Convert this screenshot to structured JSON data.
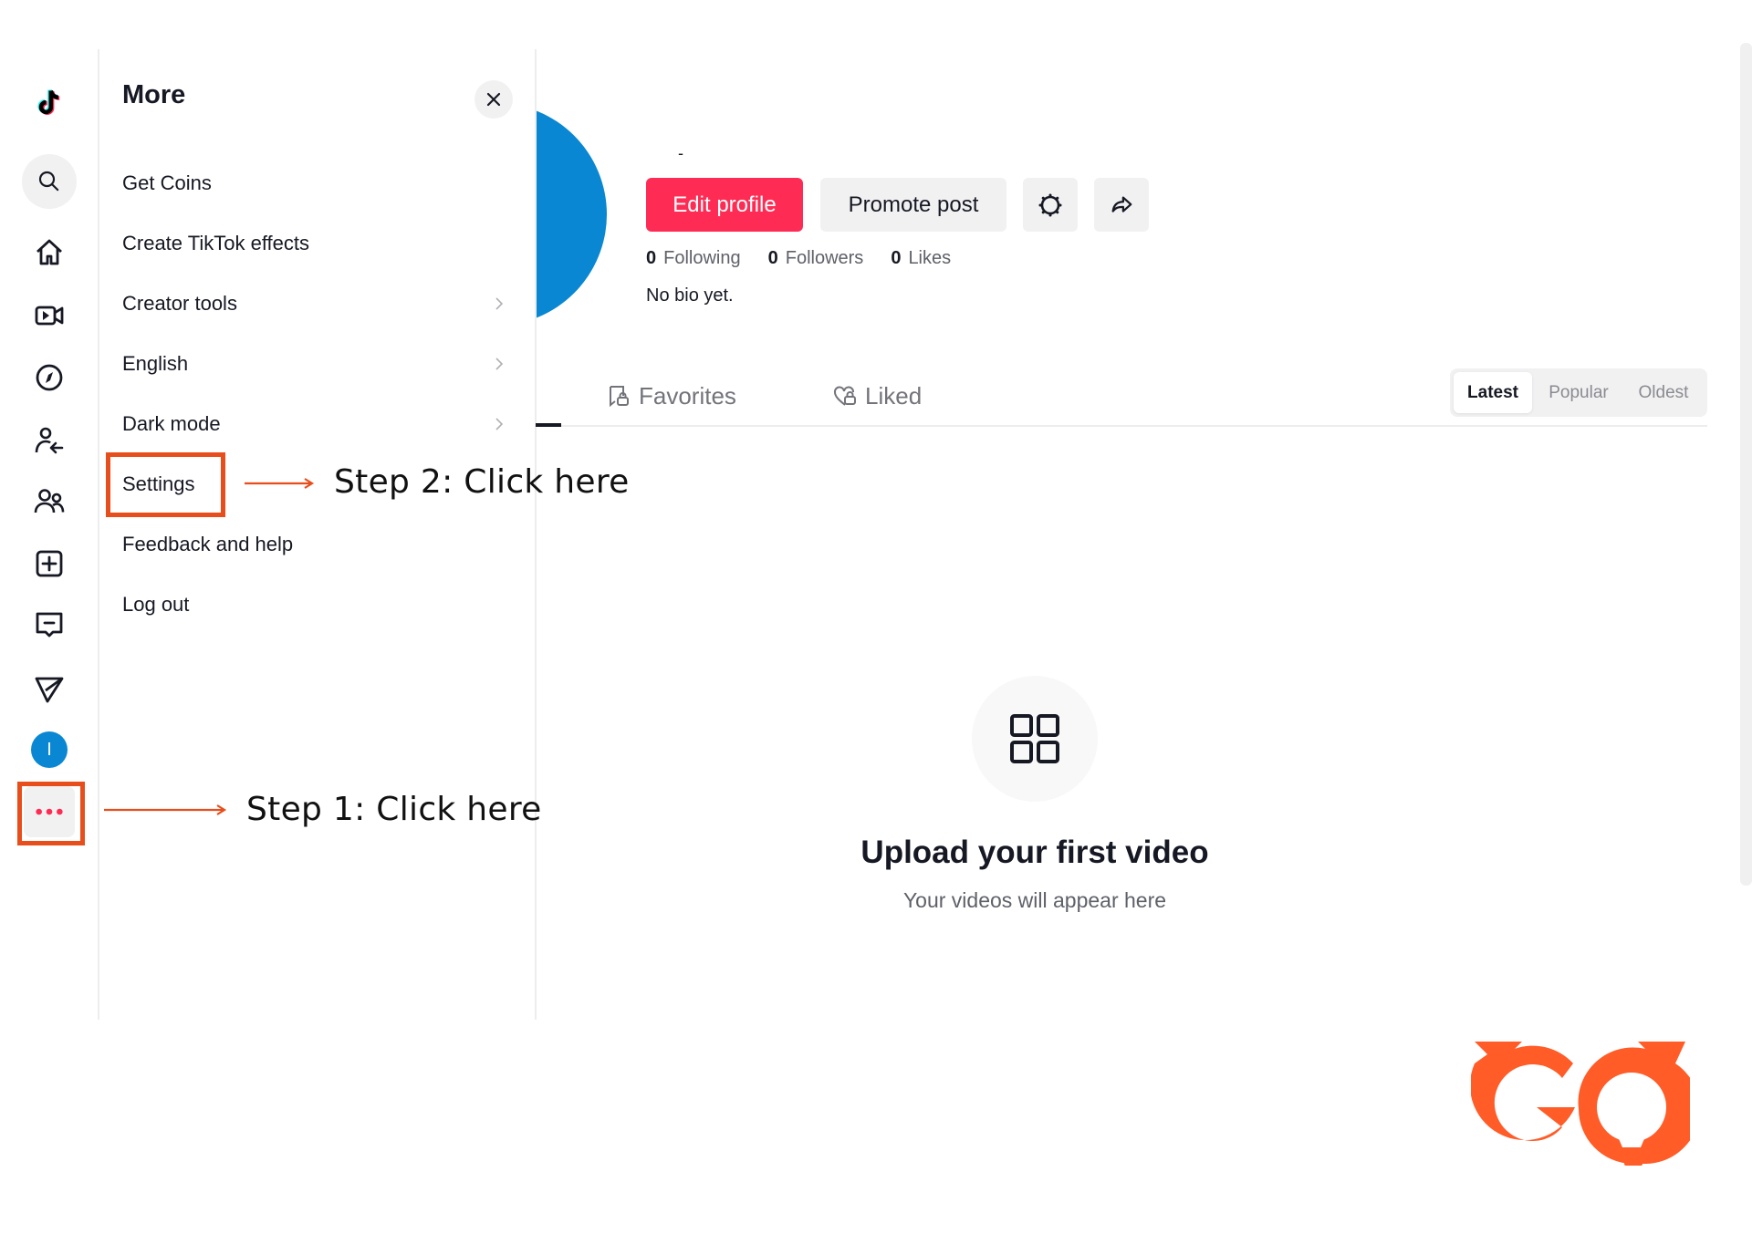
{
  "rail": {
    "items": [
      {
        "name": "tiktok-logo",
        "label": "TikTok"
      },
      {
        "name": "search",
        "label": "Search"
      },
      {
        "name": "home",
        "label": "For You"
      },
      {
        "name": "live",
        "label": "LIVE"
      },
      {
        "name": "explore",
        "label": "Explore"
      },
      {
        "name": "following",
        "label": "Following"
      },
      {
        "name": "friends",
        "label": "Friends"
      },
      {
        "name": "upload",
        "label": "Upload"
      },
      {
        "name": "activity",
        "label": "Activity"
      },
      {
        "name": "messages",
        "label": "Messages"
      },
      {
        "name": "profile",
        "label": "Profile"
      },
      {
        "name": "more",
        "label": "More"
      }
    ],
    "avatar_initial": "I",
    "accent": "#fe2c55"
  },
  "more_panel": {
    "title": "More",
    "close_label": "Close",
    "items": [
      {
        "label": "Get Coins",
        "has_submenu": false
      },
      {
        "label": "Create TikTok effects",
        "has_submenu": false
      },
      {
        "label": "Creator tools",
        "has_submenu": true
      },
      {
        "label": "English",
        "has_submenu": true
      },
      {
        "label": "Dark mode",
        "has_submenu": true
      },
      {
        "label": "Settings",
        "has_submenu": false
      },
      {
        "label": "Feedback and help",
        "has_submenu": false
      },
      {
        "label": "Log out",
        "has_submenu": false
      }
    ]
  },
  "annotations": {
    "step1": "Step 1: Click here",
    "step2": "Step 2: Click here",
    "color": "#e84e1b"
  },
  "profile": {
    "username_placeholder": "-",
    "avatar_color": "#0a87d2",
    "edit_profile": "Edit profile",
    "promote_post": "Promote post",
    "settings_icon": "gear-icon",
    "share_icon": "share-icon",
    "stats": [
      {
        "value": "0",
        "label": "Following"
      },
      {
        "value": "0",
        "label": "Followers"
      },
      {
        "value": "0",
        "label": "Likes"
      }
    ],
    "bio": "No bio yet."
  },
  "tabs": {
    "items": [
      {
        "label": "Favorites",
        "icon": "bookmark-lock-icon"
      },
      {
        "label": "Liked",
        "icon": "heart-lock-icon"
      }
    ],
    "sort": {
      "options": [
        "Latest",
        "Popular",
        "Oldest"
      ],
      "selected": "Latest"
    }
  },
  "empty_state": {
    "title": "Upload your first video",
    "subtitle": "Your videos will appear here"
  },
  "watermark": {
    "text": "GO",
    "color": "#ff5c28"
  }
}
